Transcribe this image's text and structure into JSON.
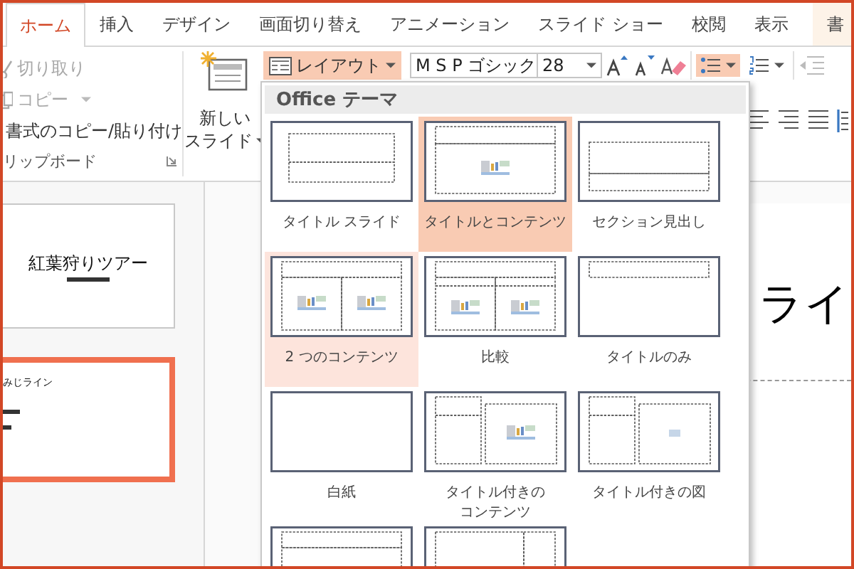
{
  "tabs": [
    {
      "label": "ホーム",
      "selected": true,
      "kind": "standard"
    },
    {
      "label": "挿入",
      "selected": false,
      "kind": "standard"
    },
    {
      "label": "デザイン",
      "selected": false,
      "kind": "standard"
    },
    {
      "label": "画面切り替え",
      "selected": false,
      "kind": "standard"
    },
    {
      "label": "アニメーション",
      "selected": false,
      "kind": "standard"
    },
    {
      "label": "スライド ショー",
      "selected": false,
      "kind": "standard"
    },
    {
      "label": "校閲",
      "selected": false,
      "kind": "standard"
    },
    {
      "label": "表示",
      "selected": false,
      "kind": "standard"
    },
    {
      "label": "書",
      "selected": false,
      "kind": "contextual"
    }
  ],
  "clipboard": {
    "items": [
      {
        "kind": "cut",
        "label": "切り取り",
        "disabled": true
      },
      {
        "kind": "copy",
        "label": "コピー",
        "disabled": true
      },
      {
        "kind": "painter",
        "label": "書式のコピー/貼り付け",
        "disabled": false
      }
    ],
    "group_label": "リップボード"
  },
  "slides_group": {
    "new_slide_lines": [
      "新しい",
      "スライド"
    ],
    "layout_button": {
      "label": "レイアウト",
      "open": true
    }
  },
  "font": {
    "name": "M S P ゴシック",
    "size": "28"
  },
  "paragraph": {
    "bullets_on": true
  },
  "slides": [
    {
      "title": "紅葉狩りツアー",
      "selected": false
    },
    {
      "title": "みじライン",
      "selected": true
    }
  ],
  "main_slide": {
    "title": "ライ"
  },
  "layout_gallery": {
    "header": "Office テーマ",
    "layouts": [
      {
        "kind": "title",
        "label": "タイトル スライド",
        "selected": false,
        "hovered": false
      },
      {
        "kind": "title-content",
        "label": "タイトルとコンテンツ",
        "selected": true,
        "hovered": false
      },
      {
        "kind": "section",
        "label": "セクション見出し",
        "selected": false,
        "hovered": false
      },
      {
        "kind": "two-content",
        "label": "2 つのコンテンツ",
        "selected": false,
        "hovered": true
      },
      {
        "kind": "comparison",
        "label": "比較",
        "selected": false,
        "hovered": false
      },
      {
        "kind": "title-only",
        "label": "タイトルのみ",
        "selected": false,
        "hovered": false
      },
      {
        "kind": "blank",
        "label": "白紙",
        "selected": false,
        "hovered": false
      },
      {
        "kind": "content-caption",
        "label": "タイトル付きのコンテンツ",
        "selected": false,
        "hovered": false
      },
      {
        "kind": "picture-caption",
        "label": "タイトル付きの図",
        "selected": false,
        "hovered": false
      },
      {
        "kind": "vertical-text",
        "selected": false,
        "hovered": false
      },
      {
        "kind": "vertical-title",
        "selected": false,
        "hovered": false
      }
    ]
  }
}
